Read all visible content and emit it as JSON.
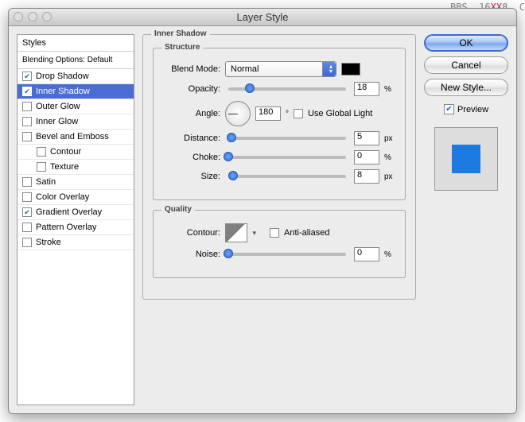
{
  "title": "Layer Style",
  "watermark": {
    "prefix": "BBS. 16",
    "highlight": "XX",
    "suffix": "8. C"
  },
  "styles_panel": {
    "header": "Styles",
    "blending": "Blending Options: Default",
    "items": [
      {
        "label": "Drop Shadow",
        "checked": true,
        "selected": false
      },
      {
        "label": "Inner Shadow",
        "checked": true,
        "selected": true
      },
      {
        "label": "Outer Glow",
        "checked": false,
        "selected": false
      },
      {
        "label": "Inner Glow",
        "checked": false,
        "selected": false
      },
      {
        "label": "Bevel and Emboss",
        "checked": false,
        "selected": false
      },
      {
        "label": "Contour",
        "checked": false,
        "selected": false,
        "sub": true
      },
      {
        "label": "Texture",
        "checked": false,
        "selected": false,
        "sub": true
      },
      {
        "label": "Satin",
        "checked": false,
        "selected": false
      },
      {
        "label": "Color Overlay",
        "checked": false,
        "selected": false
      },
      {
        "label": "Gradient Overlay",
        "checked": true,
        "selected": false
      },
      {
        "label": "Pattern Overlay",
        "checked": false,
        "selected": false
      },
      {
        "label": "Stroke",
        "checked": false,
        "selected": false
      }
    ]
  },
  "main": {
    "title": "Inner Shadow",
    "structure": {
      "title": "Structure",
      "blend_mode_label": "Blend Mode:",
      "blend_mode_value": "Normal",
      "color": "#000000",
      "opacity_label": "Opacity:",
      "opacity_value": "18",
      "opacity_unit": "%",
      "angle_label": "Angle:",
      "angle_value": "180",
      "angle_unit": "°",
      "use_global_label": "Use Global Light",
      "use_global_checked": false,
      "distance_label": "Distance:",
      "distance_value": "5",
      "distance_unit": "px",
      "choke_label": "Choke:",
      "choke_value": "0",
      "choke_unit": "%",
      "size_label": "Size:",
      "size_value": "8",
      "size_unit": "px"
    },
    "quality": {
      "title": "Quality",
      "contour_label": "Contour:",
      "antialiased_label": "Anti-aliased",
      "antialiased_checked": false,
      "noise_label": "Noise:",
      "noise_value": "0",
      "noise_unit": "%"
    }
  },
  "right": {
    "ok": "OK",
    "cancel": "Cancel",
    "new_style": "New Style...",
    "preview_label": "Preview",
    "preview_checked": true,
    "preview_color": "#1c7ae0"
  }
}
